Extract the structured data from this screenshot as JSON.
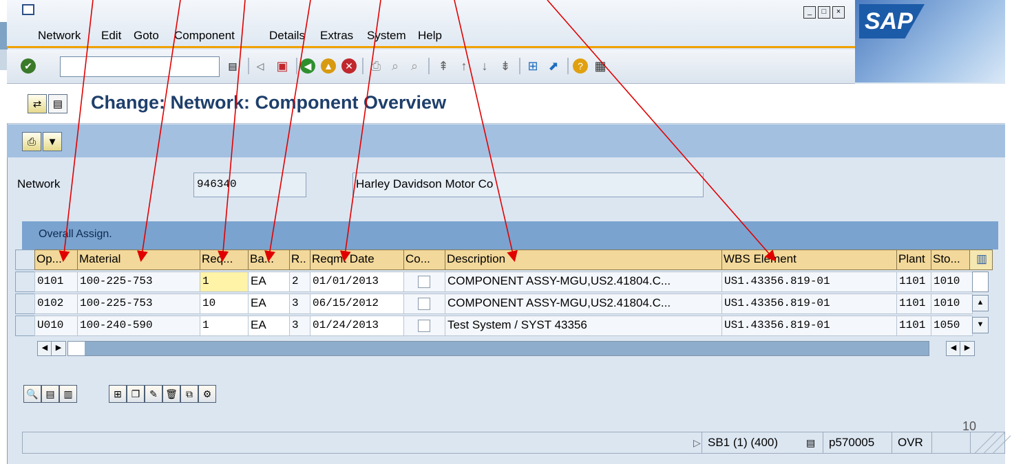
{
  "menu": [
    "Network",
    "Edit",
    "Goto",
    "Component",
    "Details",
    "Extras",
    "System",
    "Help"
  ],
  "brand": "SAP",
  "title": "Change: Network: Component Overview",
  "network": {
    "label": "Network",
    "number": "946340",
    "description": "Harley Davidson Motor Co"
  },
  "table": {
    "title": "Overall Assign.",
    "columns": [
      "Op...",
      "Material",
      "Req...",
      "Ba...",
      "R..",
      "Reqmt Date",
      "Co...",
      "Description",
      "WBS Element",
      "Plant",
      "Sto..."
    ],
    "rows": [
      {
        "op": "0101",
        "material": "100-225-753",
        "req": "1",
        "ba": "EA",
        "r": "2",
        "date": "01/01/2013",
        "desc": "COMPONENT ASSY-MGU,US2.41804.C...",
        "wbs": "US1.43356.819-01",
        "plant": "1101",
        "sto": "1010"
      },
      {
        "op": "0102",
        "material": "100-225-753",
        "req": "10",
        "ba": "EA",
        "r": "3",
        "date": "06/15/2012",
        "desc": "COMPONENT ASSY-MGU,US2.41804.C...",
        "wbs": "US1.43356.819-01",
        "plant": "1101",
        "sto": "1010"
      },
      {
        "op": "U010",
        "material": "100-240-590",
        "req": "1",
        "ba": "EA",
        "r": "3",
        "date": "01/24/2013",
        "desc": "Test System / SYST 43356",
        "wbs": "US1.43356.819-01",
        "plant": "1101",
        "sto": "1050"
      }
    ]
  },
  "status": {
    "system": "SB1 (1) (400)",
    "user": "p570005",
    "mode": "OVR"
  },
  "page_number": "10",
  "colors": {
    "accent_orange": "#f0a000",
    "table_header": "#f2d89a",
    "annotation_arrow": "#e00000"
  }
}
